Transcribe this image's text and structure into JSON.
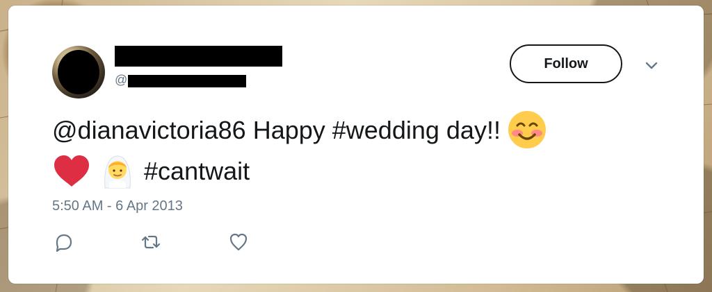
{
  "tweet": {
    "handle_prefix": "@",
    "follow_label": "Follow",
    "text_line1": "@dianavictoria86 Happy #wedding day!!",
    "text_line2": "#cantwait",
    "timestamp": "5:50 AM - 6 Apr 2013",
    "emojis": [
      "smiling-face-emoji",
      "red-heart-emoji",
      "bride-with-veil-emoji"
    ],
    "icons": {
      "reply": "reply-icon",
      "retweet": "retweet-icon",
      "like": "heart-icon",
      "more": "chevron-down-icon"
    },
    "colors": {
      "text": "#14171a",
      "secondary_text": "#657786",
      "heart_emoji": "#dd2e44",
      "smile_emoji": "#ffcc4d"
    }
  }
}
